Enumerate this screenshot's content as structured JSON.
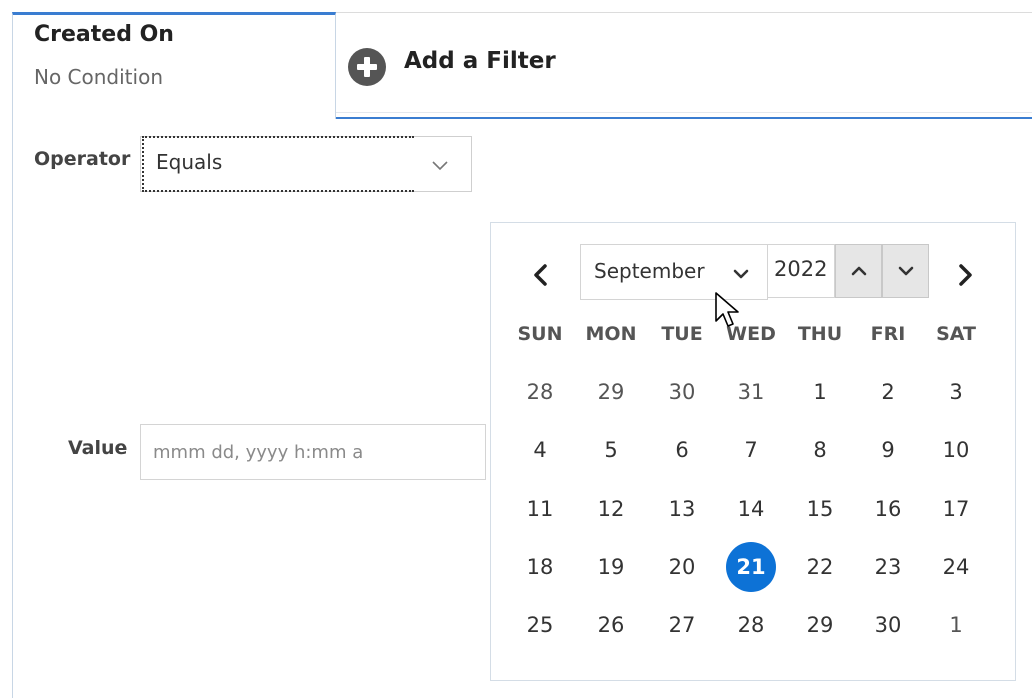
{
  "tabs": {
    "active": {
      "title": "Created On",
      "subtitle": "No Condition"
    },
    "add_filter": {
      "label": "Add a Filter",
      "icon": "plus-circle-icon"
    }
  },
  "operator": {
    "label": "Operator",
    "value": "Equals",
    "icon": "chevron-down-icon"
  },
  "value_field": {
    "label": "Value",
    "placeholder": "mmm dd, yyyy h:mm a",
    "value": ""
  },
  "calendar": {
    "month": "September",
    "year": "2022",
    "prev_icon": "chevron-left-icon",
    "next_icon": "chevron-right-icon",
    "weekdays": [
      "SUN",
      "MON",
      "TUE",
      "WED",
      "THU",
      "FRI",
      "SAT"
    ],
    "weeks": [
      [
        {
          "d": "28",
          "other": true
        },
        {
          "d": "29",
          "other": true
        },
        {
          "d": "30",
          "other": true
        },
        {
          "d": "31",
          "other": true
        },
        {
          "d": "1"
        },
        {
          "d": "2"
        },
        {
          "d": "3"
        }
      ],
      [
        {
          "d": "4"
        },
        {
          "d": "5"
        },
        {
          "d": "6"
        },
        {
          "d": "7"
        },
        {
          "d": "8"
        },
        {
          "d": "9"
        },
        {
          "d": "10"
        }
      ],
      [
        {
          "d": "11"
        },
        {
          "d": "12"
        },
        {
          "d": "13"
        },
        {
          "d": "14"
        },
        {
          "d": "15"
        },
        {
          "d": "16"
        },
        {
          "d": "17"
        }
      ],
      [
        {
          "d": "18"
        },
        {
          "d": "19"
        },
        {
          "d": "20"
        },
        {
          "d": "21",
          "selected": true
        },
        {
          "d": "22"
        },
        {
          "d": "23"
        },
        {
          "d": "24"
        }
      ],
      [
        {
          "d": "25"
        },
        {
          "d": "26"
        },
        {
          "d": "27"
        },
        {
          "d": "28"
        },
        {
          "d": "29"
        },
        {
          "d": "30"
        },
        {
          "d": "1",
          "other": true
        }
      ]
    ],
    "selected_color": "#0d72d6"
  },
  "colors": {
    "tab_accent": "#3a7dd1",
    "selected_day": "#0d72d6",
    "add_icon": "#555555"
  }
}
